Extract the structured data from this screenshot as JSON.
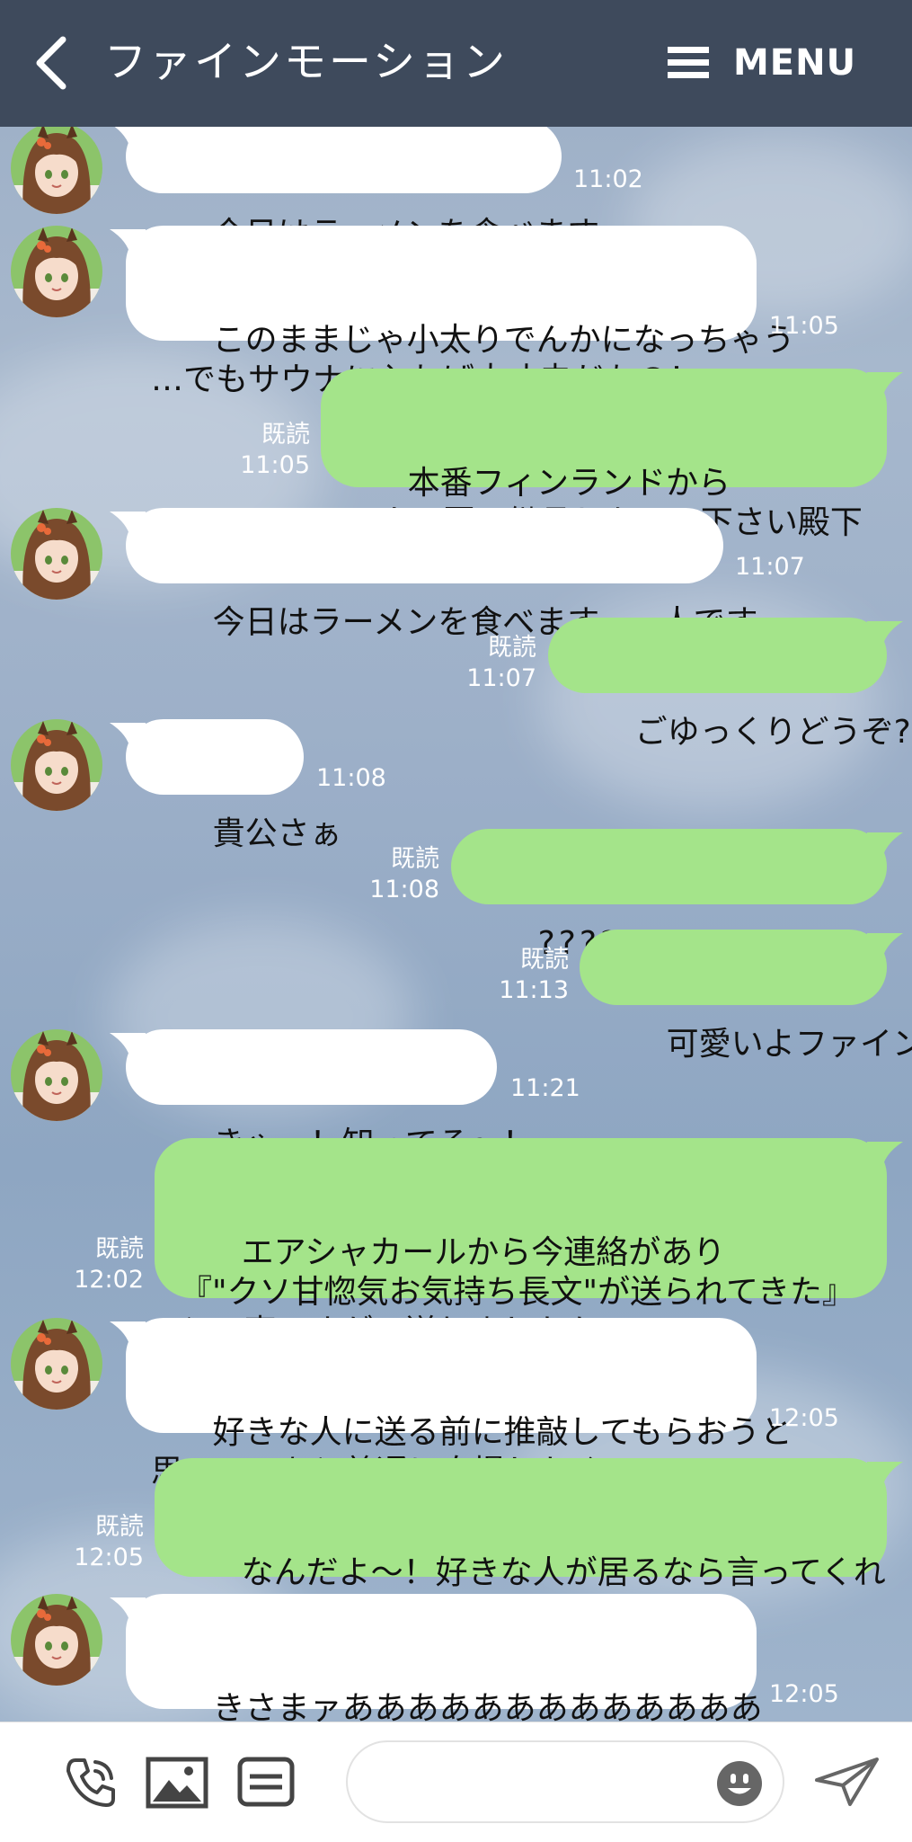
{
  "header": {
    "title": "ファインモーション",
    "menu_label": "MENU"
  },
  "messages": [
    {
      "side": "in",
      "text": "今日はラーメンを食べます",
      "time": "11:02"
    },
    {
      "side": "in",
      "text": "このままじゃ小太りでんかになっちゃう\n…でもサウナに入れば大丈夫だもの！",
      "time": "11:05"
    },
    {
      "side": "out",
      "text": "本番フィンランドから\nサウナ因子継承しないで下さい殿下",
      "read": "既読",
      "time": "11:05"
    },
    {
      "side": "in",
      "text": "今日はラーメンを食べます。一人です",
      "time": "11:07"
    },
    {
      "side": "out",
      "text": "ごゆっくりどうぞ?",
      "read": "既読",
      "time": "11:07"
    },
    {
      "side": "in",
      "text": "貴公さぁ",
      "time": "11:08"
    },
    {
      "side": "out",
      "text": "????????????",
      "read": "既読",
      "time": "11:08"
    },
    {
      "side": "out",
      "text": "可愛いよファイン",
      "read": "既読",
      "time": "11:13"
    },
    {
      "side": "in",
      "text": "きゃー！知ってる〜！",
      "time": "11:21"
    },
    {
      "side": "out",
      "text": "エアシャカールから今連絡があり\n『\"クソ甘惚気お気持ち長文\"が送られてきた』\nとの事ですが、送りましたか",
      "read": "既読",
      "time": "12:02"
    },
    {
      "side": "in",
      "text": "好きな人に送る前に推敲してもらおうと\n思って…あと普通に自慢したくって…",
      "time": "12:05"
    },
    {
      "side": "out",
      "text": "なんだよ〜！好きな人が居るなら言ってくれ\nよ！！俺もその恋応援するよ！！",
      "read": "既読",
      "time": "12:05"
    },
    {
      "side": "in",
      "text": "きさまァあああああああああああああ\nあぁぁああああああ！！！！！！！！",
      "time": "12:05"
    }
  ],
  "footer": {
    "icons": [
      "phone-icon",
      "image-icon",
      "keyboard-icon",
      "emoji-icon",
      "send-icon"
    ]
  },
  "colors": {
    "header": "#3e4a5c",
    "bubble_out": "#a4e48a",
    "bubble_in": "#ffffff"
  }
}
